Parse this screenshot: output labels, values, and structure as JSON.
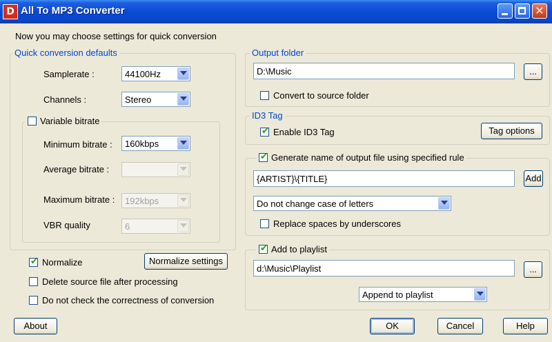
{
  "window": {
    "title": "All To MP3 Converter",
    "app_icon_glyph": "D",
    "minimize_icon": "minimize-icon",
    "maximize_icon": "maximize-icon",
    "close_icon": "close-icon",
    "close_glyph": "✕"
  },
  "intro": "Now you may choose settings for quick conversion",
  "quick": {
    "legend": "Quick conversion defaults",
    "samplerate_label": "Samplerate :",
    "samplerate_value": "44100Hz",
    "channels_label": "Channels :",
    "channels_value": "Stereo",
    "variable_bitrate_label": "Variable bitrate",
    "variable_bitrate_checked": false,
    "min_bitrate_label": "Minimum bitrate :",
    "min_bitrate_value": "160kbps",
    "avg_bitrate_label": "Average bitrate :",
    "avg_bitrate_value": "",
    "max_bitrate_label": "Maximum bitrate :",
    "max_bitrate_value": "192kbps",
    "vbr_quality_label": "VBR quality",
    "vbr_quality_value": "6"
  },
  "options": {
    "normalize_label": "Normalize",
    "normalize_checked": true,
    "normalize_settings_button": "Normalize settings",
    "delete_source_label": "Delete source file after processing",
    "delete_source_checked": false,
    "no_check_label": "Do not check the correctness of conversion",
    "no_check_checked": false
  },
  "output": {
    "legend": "Output folder",
    "folder_value": "D:\\Music",
    "browse_button": "...",
    "convert_to_source_label": "Convert to source folder",
    "convert_to_source_checked": false
  },
  "id3": {
    "legend": "ID3 Tag",
    "enable_label": "Enable ID3 Tag",
    "enable_checked": true,
    "tag_options_button": "Tag options"
  },
  "naming": {
    "generate_label": "Generate name of output file using specified rule",
    "generate_checked": true,
    "rule_value": "{ARTIST}\\{TITLE}",
    "add_button": "Add",
    "case_value": "Do not change case of letters",
    "replace_spaces_label": "Replace spaces by underscores",
    "replace_spaces_checked": false
  },
  "playlist": {
    "add_label": "Add to playlist",
    "add_checked": true,
    "path_value": "d:\\Music\\Playlist",
    "browse_button": "...",
    "mode_value": "Append to playlist"
  },
  "footer": {
    "about_button": "About",
    "ok_button": "OK",
    "cancel_button": "Cancel",
    "help_button": "Help"
  },
  "colors": {
    "accent": "#0046d5",
    "checkmark": "#21a121",
    "titlebar": "#0a4ad6"
  }
}
